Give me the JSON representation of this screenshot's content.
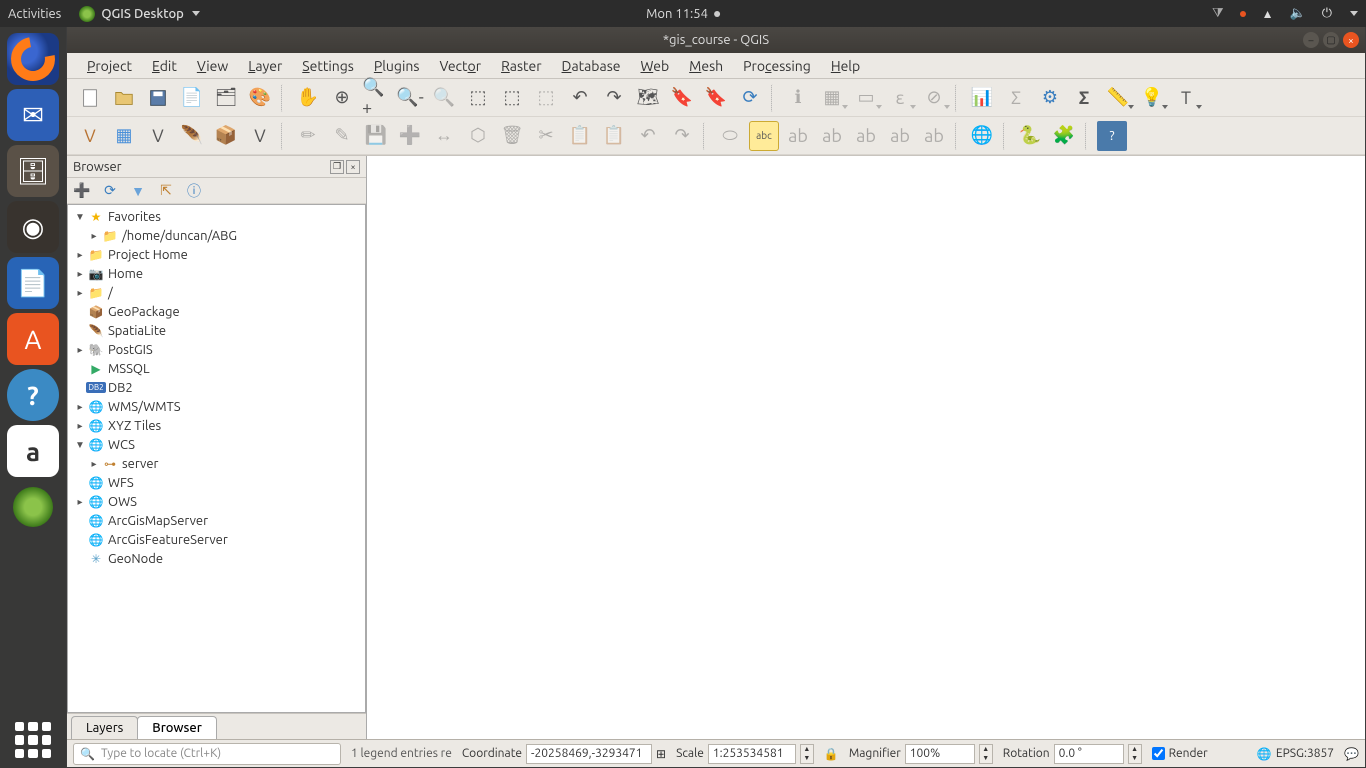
{
  "ubuntu": {
    "activities": "Activities",
    "app": "QGIS Desktop",
    "clock": "Mon 11:54"
  },
  "window": {
    "title": "*gis_course - QGIS"
  },
  "menu": [
    "Project",
    "Edit",
    "View",
    "Layer",
    "Settings",
    "Plugins",
    "Vector",
    "Raster",
    "Database",
    "Web",
    "Mesh",
    "Processing",
    "Help"
  ],
  "browser": {
    "title": "Browser",
    "items": [
      {
        "label": "Favorites",
        "exp": "▼",
        "depth": 0,
        "icon": "star"
      },
      {
        "label": "/home/duncan/ABG",
        "exp": "▸",
        "depth": 1,
        "icon": "folder"
      },
      {
        "label": "Project Home",
        "exp": "▸",
        "depth": 0,
        "icon": "folder-green"
      },
      {
        "label": "Home",
        "exp": "▸",
        "depth": 0,
        "icon": "home"
      },
      {
        "label": "/",
        "exp": "▸",
        "depth": 0,
        "icon": "folder"
      },
      {
        "label": "GeoPackage",
        "exp": "",
        "depth": 0,
        "icon": "gpkg"
      },
      {
        "label": "SpatiaLite",
        "exp": "",
        "depth": 0,
        "icon": "feather"
      },
      {
        "label": "PostGIS",
        "exp": "▸",
        "depth": 0,
        "icon": "elephant"
      },
      {
        "label": "MSSQL",
        "exp": "",
        "depth": 0,
        "icon": "mssql"
      },
      {
        "label": "DB2",
        "exp": "",
        "depth": 0,
        "icon": "db2"
      },
      {
        "label": "WMS/WMTS",
        "exp": "▸",
        "depth": 0,
        "icon": "globe"
      },
      {
        "label": "XYZ Tiles",
        "exp": "▸",
        "depth": 0,
        "icon": "globe"
      },
      {
        "label": "WCS",
        "exp": "▼",
        "depth": 0,
        "icon": "globe"
      },
      {
        "label": "server",
        "exp": "▸",
        "depth": 1,
        "icon": "conn"
      },
      {
        "label": "WFS",
        "exp": "",
        "depth": 0,
        "icon": "globe"
      },
      {
        "label": "OWS",
        "exp": "▸",
        "depth": 0,
        "icon": "globe"
      },
      {
        "label": "ArcGisMapServer",
        "exp": "",
        "depth": 0,
        "icon": "globe"
      },
      {
        "label": "ArcGisFeatureServer",
        "exp": "",
        "depth": 0,
        "icon": "globe"
      },
      {
        "label": "GeoNode",
        "exp": "",
        "depth": 0,
        "icon": "geonode"
      }
    ]
  },
  "tabs": {
    "layers": "Layers",
    "browser": "Browser"
  },
  "status": {
    "locator_placeholder": "Type to locate (Ctrl+K)",
    "msg": "1 legend entries re",
    "coord_label": "Coordinate",
    "coord_value": "-20258469,-3293471",
    "scale_label": "Scale",
    "scale_value": "1:253534581",
    "mag_label": "Magnifier",
    "mag_value": "100%",
    "rot_label": "Rotation",
    "rot_value": "0.0 °",
    "render": "Render",
    "crs": "EPSG:3857"
  }
}
